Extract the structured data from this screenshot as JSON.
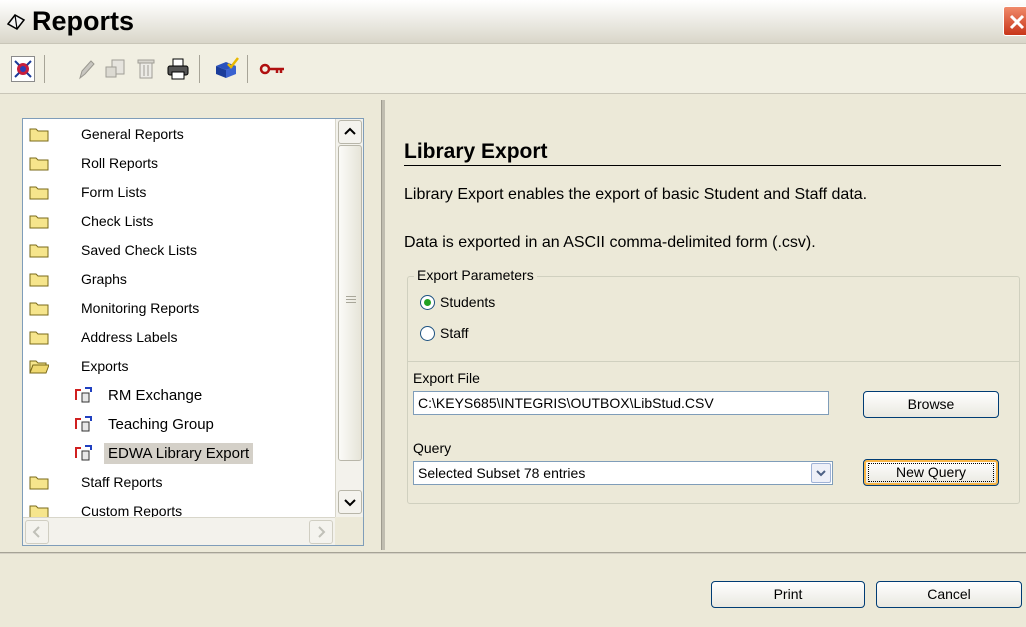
{
  "window": {
    "title": "Reports"
  },
  "toolbar": {
    "buttons": [
      {
        "icon": "reports-app-icon",
        "enabled": true
      },
      {
        "icon": "pencil-icon",
        "enabled": false
      },
      {
        "icon": "open-document-icon",
        "enabled": false
      },
      {
        "icon": "trash-icon",
        "enabled": false
      },
      {
        "icon": "printer-icon",
        "enabled": true
      },
      {
        "icon": "checklist-icon",
        "enabled": true
      },
      {
        "icon": "key-icon",
        "enabled": true
      }
    ]
  },
  "tree": {
    "items": [
      {
        "label": "General Reports",
        "type": "folder"
      },
      {
        "label": "Roll Reports",
        "type": "folder"
      },
      {
        "label": "Form Lists",
        "type": "folder"
      },
      {
        "label": "Check Lists",
        "type": "folder"
      },
      {
        "label": "Saved Check Lists",
        "type": "folder"
      },
      {
        "label": "Graphs",
        "type": "folder"
      },
      {
        "label": "Monitoring Reports",
        "type": "folder"
      },
      {
        "label": "Address Labels",
        "type": "folder"
      },
      {
        "label": "Exports",
        "type": "folder-open"
      },
      {
        "label": "RM Exchange",
        "type": "export"
      },
      {
        "label": "Teaching Group",
        "type": "export"
      },
      {
        "label": "EDWA Library Export",
        "type": "export",
        "selected": true
      },
      {
        "label": "Staff Reports",
        "type": "folder"
      },
      {
        "label": "Custom Reports",
        "type": "folder"
      }
    ]
  },
  "main": {
    "heading": "Library Export",
    "description_1": "Library Export enables the export of basic Student and Staff data.",
    "description_2": "Data is exported in an ASCII comma-delimited form (.csv).",
    "params": {
      "legend": "Export Parameters",
      "options": [
        {
          "label": "Students",
          "checked": true
        },
        {
          "label": "Staff",
          "checked": false
        }
      ]
    },
    "export_file": {
      "label": "Export File",
      "value": "C:\\KEYS685\\INTEGRIS\\OUTBOX\\LibStud.CSV",
      "browse_label": "Browse"
    },
    "query": {
      "label": "Query",
      "selected": "Selected Subset 78 entries",
      "new_query_label": "New Query"
    }
  },
  "footer": {
    "print_label": "Print",
    "cancel_label": "Cancel"
  },
  "colors": {
    "window_bg": "#ece9d8",
    "selection_bg": "#d4d0c8",
    "close_red": "#c8351a",
    "radio_green": "#21a121"
  }
}
